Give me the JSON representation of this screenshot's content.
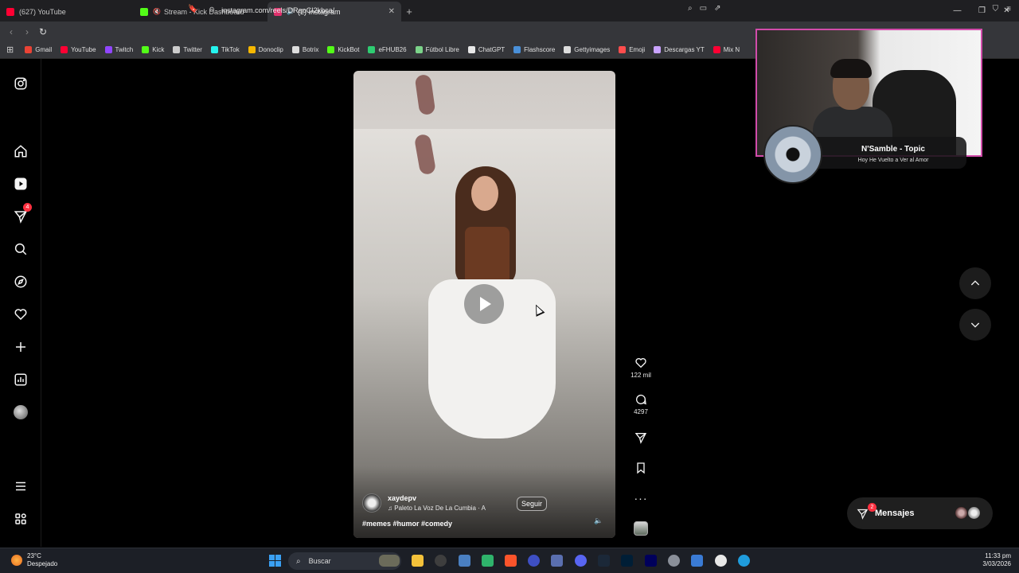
{
  "browser": {
    "tabs": [
      {
        "label": "(627) YouTube",
        "color": "#ff0033",
        "active": false
      },
      {
        "label": "Stream - Kick Dashboard",
        "color": "#53fc18",
        "active": false
      },
      {
        "label": "(2) Instagram",
        "color": "#e1306c",
        "active": true
      }
    ],
    "url": "instagram.com/reels/DRaoCI2kbca/",
    "bookmarks": [
      {
        "label": "Gmail",
        "color": "#ea4335"
      },
      {
        "label": "YouTube",
        "color": "#ff0033"
      },
      {
        "label": "Twitch",
        "color": "#9146ff"
      },
      {
        "label": "Kick",
        "color": "#53fc18"
      },
      {
        "label": "Twitter",
        "color": "#cccccc"
      },
      {
        "label": "TikTok",
        "color": "#25f4ee"
      },
      {
        "label": "Donoclip",
        "color": "#f5b700"
      },
      {
        "label": "Botrix",
        "color": "#dddddd"
      },
      {
        "label": "KickBot",
        "color": "#53fc18"
      },
      {
        "label": "eFHUB26",
        "color": "#2ecc71"
      },
      {
        "label": "Fútbol Libre",
        "color": "#7bd389"
      },
      {
        "label": "ChatGPT",
        "color": "#e8e8e8"
      },
      {
        "label": "Flashscore",
        "color": "#4a90d9"
      },
      {
        "label": "Gettyimages",
        "color": "#dddddd"
      },
      {
        "label": "Emoji",
        "color": "#ff4d4d"
      },
      {
        "label": "Descargas YT",
        "color": "#c9a3ff"
      },
      {
        "label": "Mix N",
        "color": "#ff0033"
      }
    ]
  },
  "sidenav": {
    "notification_count": "4"
  },
  "reel": {
    "author": "xaydepv",
    "audio": "Paleto La Voz De La Cumbia · A",
    "follow_label": "Seguir",
    "hashtags": "#memes #humor #comedy",
    "likes": "122 mil",
    "comments": "4297"
  },
  "messages": {
    "label": "Mensajes",
    "count": "2"
  },
  "now_playing": {
    "title": "N'Samble - Topic",
    "subtitle": "Hoy He Vuelto a Ver al Amor"
  },
  "taskbar": {
    "temp": "23°C",
    "weather": "Despejado",
    "search_label": "Buscar",
    "time": "11:33 pm",
    "date": "3/03/2026"
  }
}
